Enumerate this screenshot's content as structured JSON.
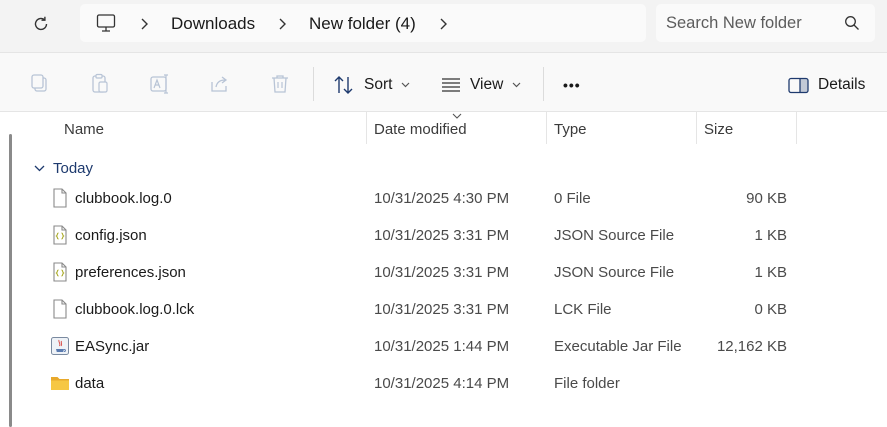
{
  "breadcrumb": {
    "root_icon": "computer-icon",
    "items": [
      "Downloads",
      "New folder (4)"
    ]
  },
  "search": {
    "placeholder": "Search New folder"
  },
  "toolbar": {
    "sort_label": "Sort",
    "view_label": "View",
    "more_label": "•••",
    "details_label": "Details"
  },
  "columns": {
    "name": "Name",
    "date": "Date modified",
    "type": "Type",
    "size": "Size"
  },
  "group": {
    "label": "Today"
  },
  "files": [
    {
      "name": "clubbook.log.0",
      "date": "10/31/2025 4:30 PM",
      "type": "0 File",
      "size": "90 KB",
      "icon": "document-icon"
    },
    {
      "name": "config.json",
      "date": "10/31/2025 3:31 PM",
      "type": "JSON Source File",
      "size": "1 KB",
      "icon": "json-file-icon"
    },
    {
      "name": "preferences.json",
      "date": "10/31/2025 3:31 PM",
      "type": "JSON Source File",
      "size": "1 KB",
      "icon": "json-file-icon"
    },
    {
      "name": "clubbook.log.0.lck",
      "date": "10/31/2025 3:31 PM",
      "type": "LCK File",
      "size": "0 KB",
      "icon": "document-icon"
    },
    {
      "name": "EASync.jar",
      "date": "10/31/2025 1:44 PM",
      "type": "Executable Jar File",
      "size": "12,162 KB",
      "icon": "java-jar-icon"
    },
    {
      "name": "data",
      "date": "10/31/2025 4:14 PM",
      "type": "File folder",
      "size": "",
      "icon": "folder-icon"
    }
  ],
  "colors": {
    "accent": "#1e3a6e",
    "folder": "#f2c13c",
    "icon_gray": "#9aa0a6"
  }
}
